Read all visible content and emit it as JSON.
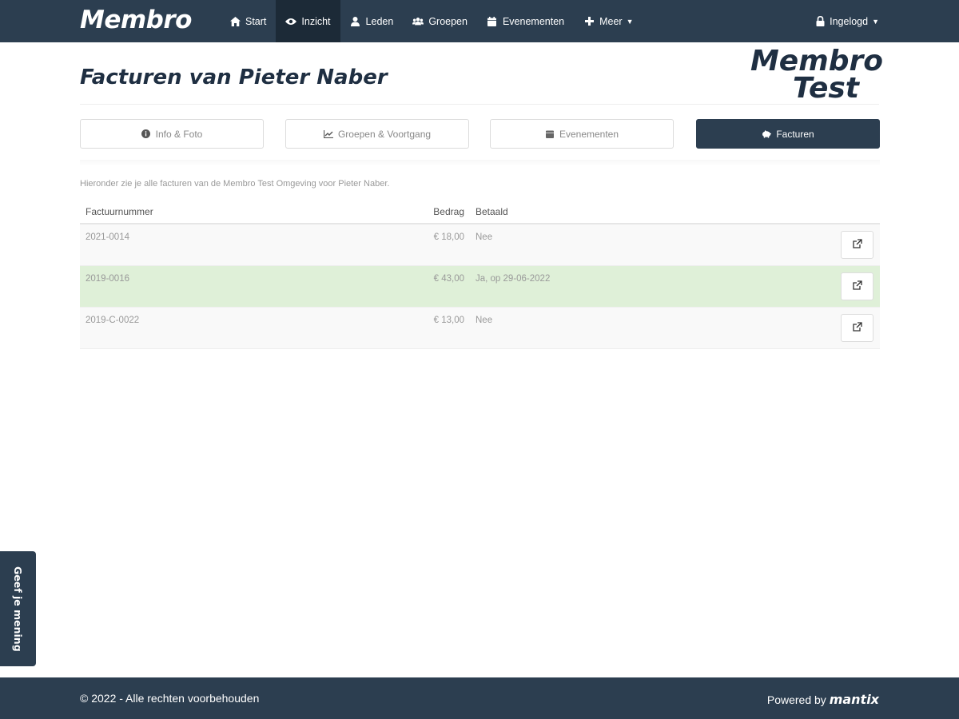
{
  "brand": "Membro",
  "nav": {
    "items": [
      {
        "label": "Start",
        "icon": "home-icon"
      },
      {
        "label": "Inzicht",
        "icon": "eye-icon"
      },
      {
        "label": "Leden",
        "icon": "user-icon"
      },
      {
        "label": "Groepen",
        "icon": "users-icon"
      },
      {
        "label": "Evenementen",
        "icon": "calendar-icon"
      },
      {
        "label": "Meer",
        "icon": "plus-icon"
      }
    ],
    "active": "Inzicht",
    "user_label": "Ingelogd"
  },
  "page": {
    "title": "Facturen van Pieter Naber",
    "logo_line1": "Membro",
    "logo_line2": "Test"
  },
  "tabs": [
    {
      "label": "Info & Foto",
      "icon": "info-circle-icon"
    },
    {
      "label": "Groepen & Voortgang",
      "icon": "line-chart-icon"
    },
    {
      "label": "Evenementen",
      "icon": "calendar-icon"
    },
    {
      "label": "Facturen",
      "icon": "piggy-bank-icon"
    }
  ],
  "invoices": {
    "intro": "Hieronder zie je alle facturen van de Membro Test Omgeving voor Pieter Naber.",
    "columns": {
      "number": "Factuurnummer",
      "amount": "Bedrag",
      "paid": "Betaald"
    },
    "rows": [
      {
        "number": "2021-0014",
        "amount": "€ 18,00",
        "paid": "Nee"
      },
      {
        "number": "2019-0016",
        "amount": "€ 43,00",
        "paid": "Ja, op 29-06-2022"
      },
      {
        "number": "2019-C-0022",
        "amount": "€ 13,00",
        "paid": "Nee"
      }
    ]
  },
  "feedback_label": "Geef je mening",
  "footer": {
    "copyright": "© 2022 - Alle rechten voorbehouden",
    "powered_by": "Powered by",
    "powered_brand": "mantix"
  },
  "colors": {
    "navbar": "#2c3e50",
    "active_nav": "#1c2a37",
    "paid_row": "#dff0d8",
    "title": "#1f2f42"
  }
}
